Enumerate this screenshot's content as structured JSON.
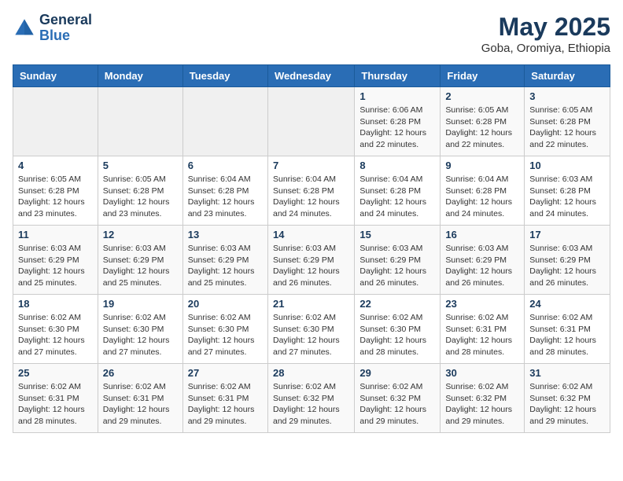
{
  "logo": {
    "line1": "General",
    "line2": "Blue"
  },
  "title": {
    "month_year": "May 2025",
    "location": "Goba, Oromiya, Ethiopia"
  },
  "days_of_week": [
    "Sunday",
    "Monday",
    "Tuesday",
    "Wednesday",
    "Thursday",
    "Friday",
    "Saturday"
  ],
  "weeks": [
    [
      {
        "day": "",
        "info": ""
      },
      {
        "day": "",
        "info": ""
      },
      {
        "day": "",
        "info": ""
      },
      {
        "day": "",
        "info": ""
      },
      {
        "day": "1",
        "info": "Sunrise: 6:06 AM\nSunset: 6:28 PM\nDaylight: 12 hours\nand 22 minutes."
      },
      {
        "day": "2",
        "info": "Sunrise: 6:05 AM\nSunset: 6:28 PM\nDaylight: 12 hours\nand 22 minutes."
      },
      {
        "day": "3",
        "info": "Sunrise: 6:05 AM\nSunset: 6:28 PM\nDaylight: 12 hours\nand 22 minutes."
      }
    ],
    [
      {
        "day": "4",
        "info": "Sunrise: 6:05 AM\nSunset: 6:28 PM\nDaylight: 12 hours\nand 23 minutes."
      },
      {
        "day": "5",
        "info": "Sunrise: 6:05 AM\nSunset: 6:28 PM\nDaylight: 12 hours\nand 23 minutes."
      },
      {
        "day": "6",
        "info": "Sunrise: 6:04 AM\nSunset: 6:28 PM\nDaylight: 12 hours\nand 23 minutes."
      },
      {
        "day": "7",
        "info": "Sunrise: 6:04 AM\nSunset: 6:28 PM\nDaylight: 12 hours\nand 24 minutes."
      },
      {
        "day": "8",
        "info": "Sunrise: 6:04 AM\nSunset: 6:28 PM\nDaylight: 12 hours\nand 24 minutes."
      },
      {
        "day": "9",
        "info": "Sunrise: 6:04 AM\nSunset: 6:28 PM\nDaylight: 12 hours\nand 24 minutes."
      },
      {
        "day": "10",
        "info": "Sunrise: 6:03 AM\nSunset: 6:28 PM\nDaylight: 12 hours\nand 24 minutes."
      }
    ],
    [
      {
        "day": "11",
        "info": "Sunrise: 6:03 AM\nSunset: 6:29 PM\nDaylight: 12 hours\nand 25 minutes."
      },
      {
        "day": "12",
        "info": "Sunrise: 6:03 AM\nSunset: 6:29 PM\nDaylight: 12 hours\nand 25 minutes."
      },
      {
        "day": "13",
        "info": "Sunrise: 6:03 AM\nSunset: 6:29 PM\nDaylight: 12 hours\nand 25 minutes."
      },
      {
        "day": "14",
        "info": "Sunrise: 6:03 AM\nSunset: 6:29 PM\nDaylight: 12 hours\nand 26 minutes."
      },
      {
        "day": "15",
        "info": "Sunrise: 6:03 AM\nSunset: 6:29 PM\nDaylight: 12 hours\nand 26 minutes."
      },
      {
        "day": "16",
        "info": "Sunrise: 6:03 AM\nSunset: 6:29 PM\nDaylight: 12 hours\nand 26 minutes."
      },
      {
        "day": "17",
        "info": "Sunrise: 6:03 AM\nSunset: 6:29 PM\nDaylight: 12 hours\nand 26 minutes."
      }
    ],
    [
      {
        "day": "18",
        "info": "Sunrise: 6:02 AM\nSunset: 6:30 PM\nDaylight: 12 hours\nand 27 minutes."
      },
      {
        "day": "19",
        "info": "Sunrise: 6:02 AM\nSunset: 6:30 PM\nDaylight: 12 hours\nand 27 minutes."
      },
      {
        "day": "20",
        "info": "Sunrise: 6:02 AM\nSunset: 6:30 PM\nDaylight: 12 hours\nand 27 minutes."
      },
      {
        "day": "21",
        "info": "Sunrise: 6:02 AM\nSunset: 6:30 PM\nDaylight: 12 hours\nand 27 minutes."
      },
      {
        "day": "22",
        "info": "Sunrise: 6:02 AM\nSunset: 6:30 PM\nDaylight: 12 hours\nand 28 minutes."
      },
      {
        "day": "23",
        "info": "Sunrise: 6:02 AM\nSunset: 6:31 PM\nDaylight: 12 hours\nand 28 minutes."
      },
      {
        "day": "24",
        "info": "Sunrise: 6:02 AM\nSunset: 6:31 PM\nDaylight: 12 hours\nand 28 minutes."
      }
    ],
    [
      {
        "day": "25",
        "info": "Sunrise: 6:02 AM\nSunset: 6:31 PM\nDaylight: 12 hours\nand 28 minutes."
      },
      {
        "day": "26",
        "info": "Sunrise: 6:02 AM\nSunset: 6:31 PM\nDaylight: 12 hours\nand 29 minutes."
      },
      {
        "day": "27",
        "info": "Sunrise: 6:02 AM\nSunset: 6:31 PM\nDaylight: 12 hours\nand 29 minutes."
      },
      {
        "day": "28",
        "info": "Sunrise: 6:02 AM\nSunset: 6:32 PM\nDaylight: 12 hours\nand 29 minutes."
      },
      {
        "day": "29",
        "info": "Sunrise: 6:02 AM\nSunset: 6:32 PM\nDaylight: 12 hours\nand 29 minutes."
      },
      {
        "day": "30",
        "info": "Sunrise: 6:02 AM\nSunset: 6:32 PM\nDaylight: 12 hours\nand 29 minutes."
      },
      {
        "day": "31",
        "info": "Sunrise: 6:02 AM\nSunset: 6:32 PM\nDaylight: 12 hours\nand 29 minutes."
      }
    ]
  ]
}
